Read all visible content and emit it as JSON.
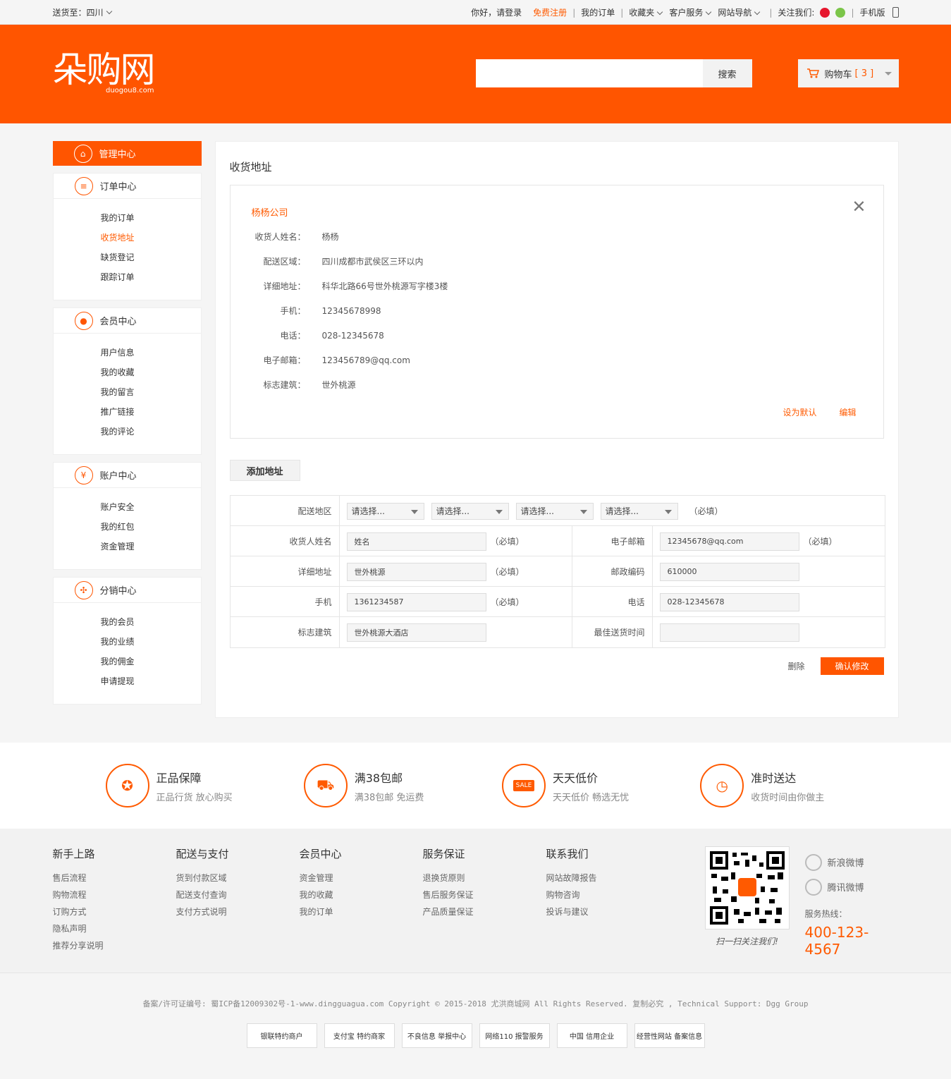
{
  "topbar": {
    "deliver_label": "送货至：",
    "deliver_region": "四川",
    "greeting": "你好，请登录",
    "register": "免费注册",
    "my_orders": "我的订单",
    "favorites": "收藏夹",
    "customer_service": "客户服务",
    "site_nav": "网站导航",
    "follow_us": "关注我们:",
    "mobile": "手机版"
  },
  "header": {
    "logo_cn": "朵购网",
    "logo_en": "duogou8.com",
    "search_placeholder": "",
    "search_button": "搜索",
    "cart_label": "购物车",
    "cart_count": "[ 3 ]"
  },
  "sidebar": {
    "head": "管理中心",
    "groups": [
      {
        "title": "订单中心",
        "items": [
          "我的订单",
          "收货地址",
          "缺货登记",
          "跟踪订单"
        ]
      },
      {
        "title": "会员中心",
        "items": [
          "用户信息",
          "我的收藏",
          "我的留言",
          "推广链接",
          "我的评论"
        ]
      },
      {
        "title": "账户中心",
        "items": [
          "账户安全",
          "我的红包",
          "资金管理"
        ]
      },
      {
        "title": "分销中心",
        "items": [
          "我的会员",
          "我的业绩",
          "我的佣金",
          "申请提现"
        ]
      }
    ]
  },
  "content": {
    "title": "收货地址",
    "card": {
      "company": "杨杨公司",
      "rows": [
        {
          "label": "收货人姓名：",
          "value": "杨杨"
        },
        {
          "label": "配送区域：",
          "value": "四川成都市武侯区三环以内"
        },
        {
          "label": "详细地址：",
          "value": "科华北路66号世外桃源写字楼3楼"
        },
        {
          "label": "手机：",
          "value": "12345678998"
        },
        {
          "label": "电话：",
          "value": "028-12345678"
        },
        {
          "label": "电子邮箱：",
          "value": "123456789@qq.com"
        },
        {
          "label": "标志建筑：",
          "value": "世外桃源"
        }
      ],
      "set_default": "设为默认",
      "edit": "编辑"
    },
    "add_button": "添加地址",
    "form": {
      "region_label": "配送地区",
      "select_placeholder": "请选择...",
      "required": "（必填）",
      "name_label": "收货人姓名",
      "name_value": "姓名",
      "email_label": "电子邮箱",
      "email_value": "12345678@qq.com",
      "address_label": "详细地址",
      "address_value": "世外桃源",
      "zip_label": "邮政编码",
      "zip_value": "610000",
      "mobile_label": "手机",
      "mobile_value": "1361234587",
      "phone_label": "电话",
      "phone_value": "028-12345678",
      "landmark_label": "标志建筑",
      "landmark_value": "世外桃源大酒店",
      "time_label": "最佳送货时间",
      "time_value": ""
    },
    "delete": "删除",
    "confirm": "确认修改"
  },
  "features": [
    {
      "title": "正品保障",
      "sub": "正品行货 放心购买"
    },
    {
      "title": "满38包邮",
      "sub": "满38包邮 免运费"
    },
    {
      "title": "天天低价",
      "sub": "天天低价 畅选无忧",
      "badge": "SALE"
    },
    {
      "title": "准时送达",
      "sub": "收货时间由你做主"
    }
  ],
  "footer": {
    "cols": [
      {
        "title": "新手上路",
        "items": [
          "售后流程",
          "购物流程",
          "订购方式",
          "隐私声明",
          "推荐分享说明"
        ]
      },
      {
        "title": "配送与支付",
        "items": [
          "货到付款区域",
          "配送支付查询",
          "支付方式说明"
        ]
      },
      {
        "title": "会员中心",
        "items": [
          "资金管理",
          "我的收藏",
          "我的订单"
        ]
      },
      {
        "title": "服务保证",
        "items": [
          "退换货原则",
          "售后服务保证",
          "产品质量保证"
        ]
      },
      {
        "title": "联系我们",
        "items": [
          "网站故障报告",
          "购物咨询",
          "投诉与建议"
        ]
      }
    ],
    "qr_caption": "扫一扫关注我们!",
    "weibo_sina": "新浪微博",
    "weibo_tencent": "腾讯微博",
    "hotline_label": "服务热线：",
    "hotline": "400-123-4567"
  },
  "copyright": "备案/许可证编号: 蜀ICP备12009302号-1-www.dingguagua.com Copyright © 2015-2018 尤洪商城网 All Rights Reserved. 复制必究 , Technical Support: Dgg Group",
  "badges": [
    "银联特约商户",
    "支付宝 特约商家",
    "不良信息 举报中心",
    "网络110 报警服务",
    "中国 信用企业",
    "经营性网站 备案信息"
  ]
}
